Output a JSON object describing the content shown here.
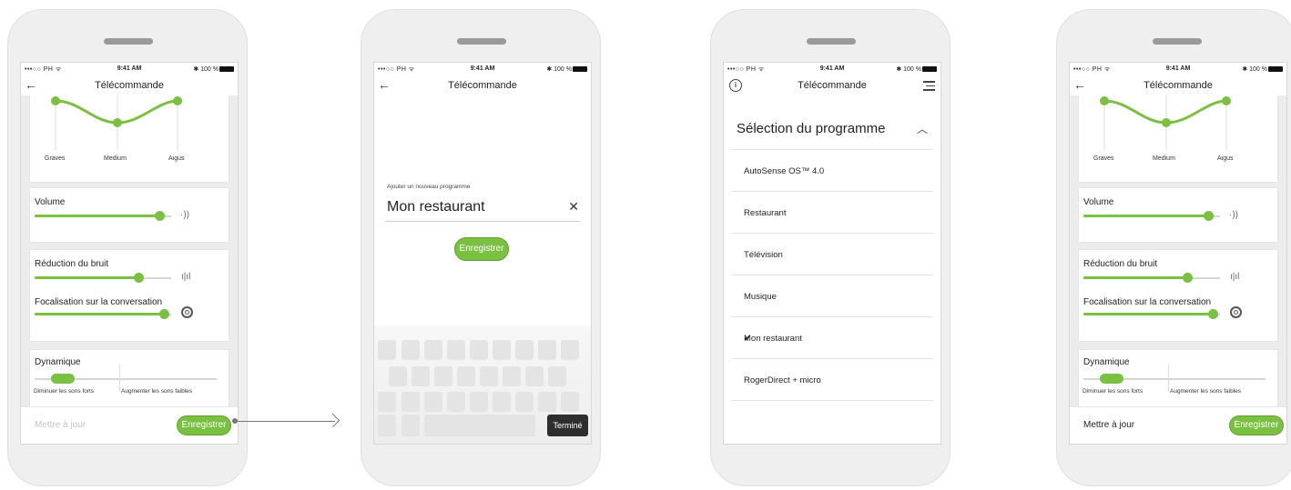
{
  "status": {
    "carrier": "•••○○ PH ᯤ",
    "time": "9:41 AM",
    "battery": "✱ 100 %"
  },
  "screen_title": "Télécommande",
  "eq": {
    "graves": "Graves",
    "medium": "Medium",
    "aigus": "Aigus"
  },
  "volume": {
    "label": "Volume",
    "value": 0.91
  },
  "noise": {
    "label": "Réduction du bruit",
    "value": 0.73
  },
  "focus": {
    "label": "Focalisation sur la conversation",
    "value": 0.95
  },
  "dynamic": {
    "label": "Dynamique",
    "left_label": "Diminuer les sons forts",
    "right_label": "Augmenter les sons faibles"
  },
  "footer": {
    "update_label": "Mettre à jour",
    "save_label": "Enregistrer"
  },
  "add_program": {
    "label": "Ajouter un nouveau programme",
    "value": "Mon restaurant",
    "save_label": "Enregistrer",
    "done_key": "Terminé"
  },
  "program_selection": {
    "title": "Sélection du programme",
    "items": [
      {
        "label": "AutoSense OS™ 4.0",
        "selected": false
      },
      {
        "label": "Restaurant",
        "selected": false
      },
      {
        "label": "Télévision",
        "selected": false
      },
      {
        "label": "Musique",
        "selected": false
      },
      {
        "label": "Mon restaurant",
        "selected": true
      },
      {
        "label": "RogerDirect + micro",
        "selected": false
      }
    ]
  },
  "colors": {
    "accent": "#7ac142",
    "keyboard_done": "#2e2e2e"
  },
  "icons": [
    "back-arrow-icon",
    "info-icon",
    "menu-icon",
    "speaker-icon",
    "waveform-icon",
    "focus-ring-icon",
    "close-icon",
    "chevron-up-icon",
    "checkmark-icon"
  ]
}
